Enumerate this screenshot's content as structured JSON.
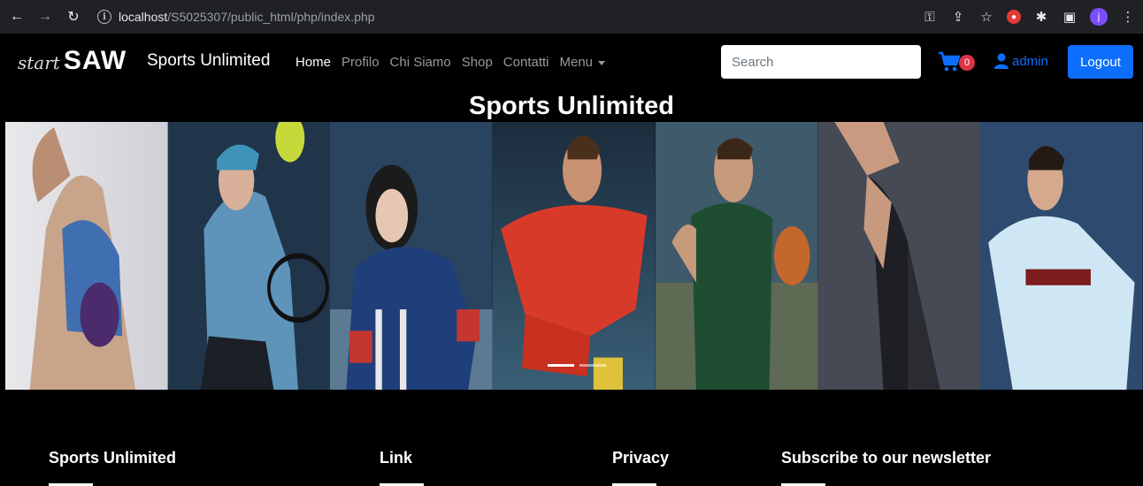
{
  "browser": {
    "url_host": "localhost",
    "url_path": "/S5025307/public_html/php/index.php"
  },
  "navbar": {
    "brand_script": "start",
    "brand_big": "SAW",
    "brand_name": "Sports Unlimited",
    "links": [
      {
        "label": "Home",
        "active": true
      },
      {
        "label": "Profilo",
        "active": false
      },
      {
        "label": "Chi Siamo",
        "active": false
      },
      {
        "label": "Shop",
        "active": false
      },
      {
        "label": "Contatti",
        "active": false
      },
      {
        "label": "Menu",
        "active": false
      }
    ],
    "search_placeholder": "Search",
    "cart_count": "0",
    "user": "admin",
    "logout": "Logout"
  },
  "hero": {
    "title": "Sports Unlimited"
  },
  "banner": {
    "panels": [
      {
        "sport": "gymnastics"
      },
      {
        "sport": "tennis"
      },
      {
        "sport": "ice-hockey"
      },
      {
        "sport": "football"
      },
      {
        "sport": "basketball"
      },
      {
        "sport": "athletics"
      },
      {
        "sport": "taekwondo"
      }
    ],
    "slides": 2,
    "active_slide": 0
  },
  "footer": {
    "columns": [
      "Sports Unlimited",
      "Link",
      "Privacy",
      "Subscribe to our newsletter"
    ]
  },
  "colors": {
    "primary": "#0d6efd",
    "badge": "#dc3545",
    "background": "#000000"
  }
}
